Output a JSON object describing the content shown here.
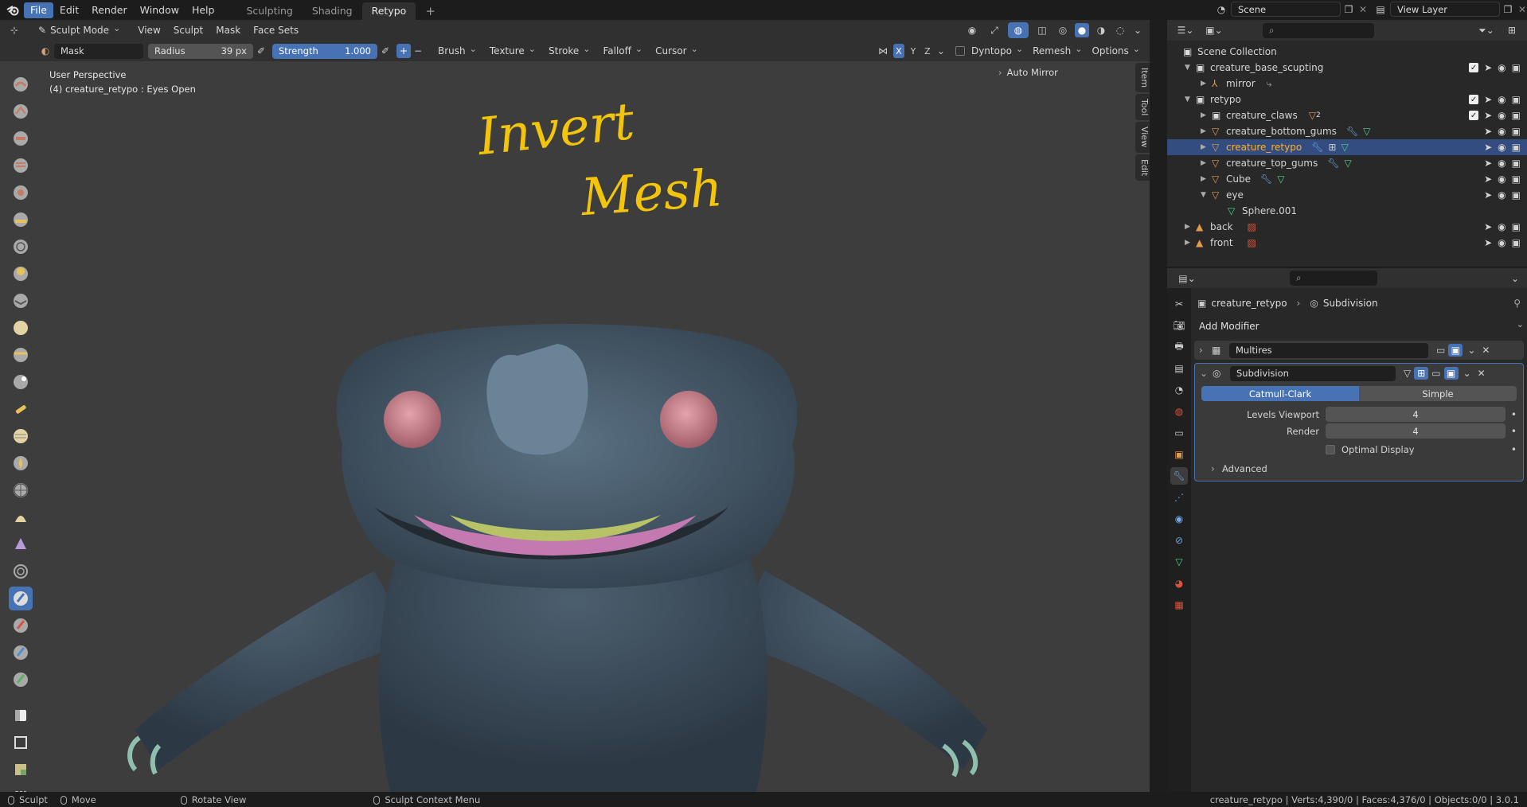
{
  "topbar": {
    "menus": [
      "File",
      "Edit",
      "Render",
      "Window",
      "Help"
    ],
    "workspaces": [
      "Sculpting",
      "Shading",
      "Retypo"
    ],
    "active_workspace": "Retypo",
    "add_tab": "+",
    "scene": "Scene",
    "view_layer": "View Layer"
  },
  "viewport_header": {
    "mode": "Sculpt Mode",
    "menus": [
      "View",
      "Sculpt",
      "Mask",
      "Face Sets"
    ]
  },
  "tool_header": {
    "brush_name": "Mask",
    "radius_label": "Radius",
    "radius_value": "39 px",
    "strength_label": "Strength",
    "strength_value": "1.000",
    "plus": "+",
    "minus": "−",
    "dropdowns": [
      "Brush",
      "Texture",
      "Stroke",
      "Falloff",
      "Cursor"
    ],
    "axes": [
      "X",
      "Y",
      "Z"
    ],
    "dyntopo": "Dyntopo",
    "remesh": "Remesh",
    "options": "Options"
  },
  "viewport": {
    "perspective": "User Perspective",
    "object_info": "(4) creature_retypo : Eyes Open",
    "auto_mirror": "Auto Mirror",
    "annotation_line1": "Invert",
    "annotation_line2": "Mesh",
    "annotation_color": "#f2c40c",
    "side_tabs": [
      "Item",
      "Tool",
      "View",
      "Edit"
    ]
  },
  "outliner": {
    "search_placeholder": "",
    "root": "Scene Collection",
    "rows": [
      {
        "label": "creature_base_scupting"
      },
      {
        "label": "mirror"
      },
      {
        "label": "retypo"
      },
      {
        "label": "creature_claws",
        "badge": "2"
      },
      {
        "label": "creature_bottom_gums"
      },
      {
        "label": "creature_retypo"
      },
      {
        "label": "creature_top_gums"
      },
      {
        "label": "Cube"
      },
      {
        "label": "eye"
      },
      {
        "label": "Sphere.001"
      },
      {
        "label": "back"
      },
      {
        "label": "front"
      }
    ]
  },
  "properties": {
    "breadcrumb_object": "creature_retypo",
    "breadcrumb_modifier": "Subdivision",
    "add_modifier": "Add Modifier",
    "modifier1": "Multires",
    "modifier2": "Subdivision",
    "catmull": "Catmull-Clark",
    "simple": "Simple",
    "levels_viewport_label": "Levels Viewport",
    "levels_viewport_value": "4",
    "render_label": "Render",
    "render_value": "4",
    "optimal_display": "Optimal Display",
    "advanced": "Advanced"
  },
  "statusbar": {
    "sculpt": "Sculpt",
    "move": "Move",
    "rotate": "Rotate View",
    "context": "Sculpt Context Menu",
    "stats": "creature_retypo | Verts:4,390/0 | Faces:4,376/0 | Objects:0/0 | 3.0.1"
  },
  "colors": {
    "accent": "#4772b3",
    "selected_row": "#334d80",
    "creature_body": "#4a5f70",
    "creature_eye": "#d18a94",
    "creature_mouth": "#c47ab0"
  }
}
